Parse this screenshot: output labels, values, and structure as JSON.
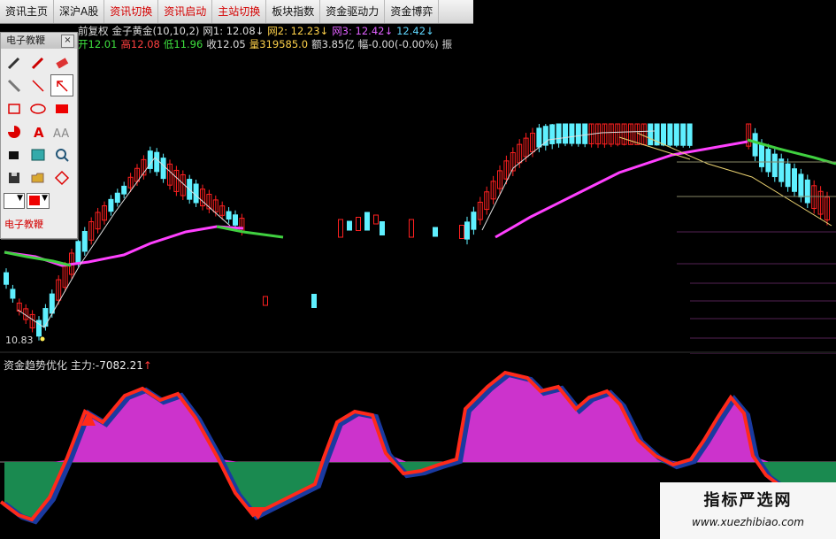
{
  "toolbar": {
    "items": [
      "资讯主页",
      "深沪A股",
      "资讯切换",
      "资讯启动",
      "主站切换",
      "板块指数",
      "资金驱动力",
      "资金博弈"
    ],
    "accent_items": [
      2,
      3,
      4
    ]
  },
  "info_line1": [
    {
      "text": "前复权",
      "color": "#dddddd"
    },
    {
      "text": "金子黄金(10,10,2)",
      "color": "#dddddd"
    },
    {
      "text": "网1: 12.08↓",
      "color": "#dddddd"
    },
    {
      "text": "网2: 12.23↓",
      "color": "#ffd24a"
    },
    {
      "text": "网3: 12.42↓",
      "color": "#e060ff"
    },
    {
      "text": "12.42↓",
      "color": "#5fd7ff"
    }
  ],
  "info_line2": [
    {
      "text": "开12.01",
      "color": "#3ee03e"
    },
    {
      "text": "高12.08",
      "color": "#ff4040"
    },
    {
      "text": "低11.96",
      "color": "#3ee03e"
    },
    {
      "text": "收12.05",
      "color": "#dddddd"
    },
    {
      "text": "量319585.0",
      "color": "#ffd24a"
    },
    {
      "text": "额3.85亿",
      "color": "#dddddd"
    },
    {
      "text": "幅-0.00(-0.00%)",
      "color": "#dddddd"
    },
    {
      "text": "振",
      "color": "#dddddd"
    }
  ],
  "palette": {
    "title": "电子教鞭",
    "close": "×",
    "footer": "电子教鞭",
    "tools": [
      "pencil-icon",
      "pen-icon",
      "eraser-icon",
      "ruler-icon",
      "line-icon",
      "arrow-icon",
      "rectangle-icon",
      "ellipse-icon",
      "filled-rect-icon",
      "pie-icon",
      "letter-a-icon",
      "letter-aa-icon",
      "fill-icon",
      "image-icon",
      "magnifier-icon",
      "save-icon",
      "folder-icon",
      "diamond-icon",
      "line-width-select",
      "color-select",
      "blank"
    ]
  },
  "main_chart": {
    "low_label": "10.83",
    "colors": {
      "up": "#ff2020",
      "down": "#5ff0ff",
      "ma_long": "#ff40ff",
      "ma_mid": "#40d040",
      "grid": "#3a1a1a"
    }
  },
  "sub_chart": {
    "label": "资金趋势优化",
    "main_force_label": "主力:",
    "main_force_value": "-7082.21",
    "arrow": "↑",
    "colors": {
      "positive": "#cc33cc",
      "negative": "#1a8a50",
      "line_up": "#ff2a1a",
      "line_down": "#1a3aa0"
    }
  },
  "watermark": {
    "title": "指标严选网",
    "url": "www.xuezhibiao.com"
  }
}
